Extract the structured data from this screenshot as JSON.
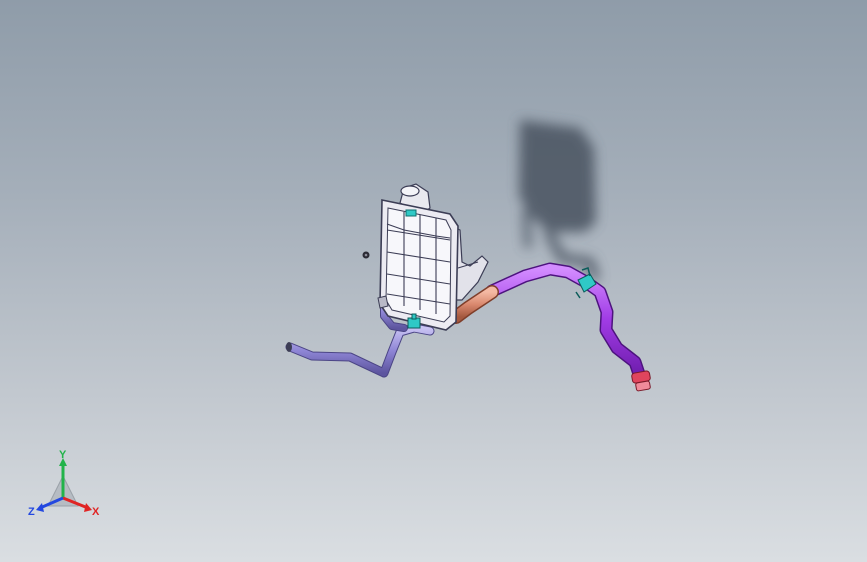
{
  "viewport": {
    "background_top": "#8f9ca9",
    "background_bottom": "#dadee2"
  },
  "model": {
    "colors": {
      "tank_outline": "#3c3d55",
      "hose_purple": "#a13ce6",
      "hose_lavender": "#8f86d6",
      "hose_copper": "#d9886e",
      "clamp_cyan": "#2fc9c6",
      "end_fitting_red": "#e0455d",
      "shadow": "#4a5260"
    }
  },
  "triad": {
    "x_label": "X",
    "y_label": "Y",
    "z_label": "Z",
    "x_color": "#e02424",
    "y_color": "#22b34a",
    "z_color": "#2348e0"
  }
}
